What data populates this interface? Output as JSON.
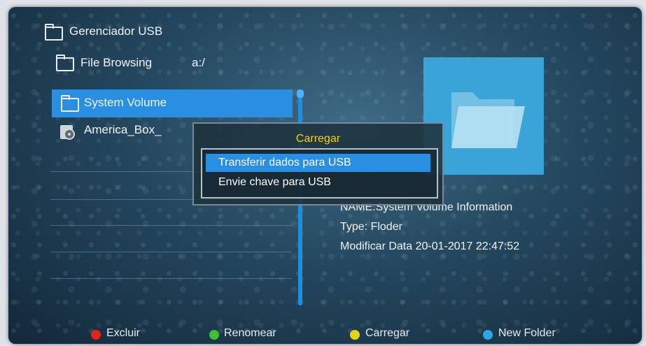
{
  "header": {
    "title": "Gerenciador USB",
    "browse_label": "File Browsing",
    "path": "a:/"
  },
  "file_list": [
    {
      "name": "System Volume",
      "type": "folder",
      "selected": true
    },
    {
      "name": "America_Box_",
      "type": "usb-file",
      "selected": false
    }
  ],
  "dialog": {
    "title": "Carregar",
    "options": [
      "Transferir dados para USB",
      "Envie chave para USB"
    ],
    "selected_index": 0
  },
  "info": {
    "name": "NAME:System Volume Information",
    "type": "Type: Floder",
    "date": "Modificar Data  20-01-2017 22:47:52"
  },
  "footer": {
    "buttons": [
      {
        "label": "Excluir",
        "color": "#e2241b"
      },
      {
        "label": "Renomear",
        "color": "#3fbf32"
      },
      {
        "label": "Carregar",
        "color": "#e9d21a"
      },
      {
        "label": "New Folder",
        "color": "#2aa7e6"
      }
    ]
  },
  "colors": {
    "highlight": "#2a8fe0",
    "dialog_title": "#f3d21b"
  }
}
